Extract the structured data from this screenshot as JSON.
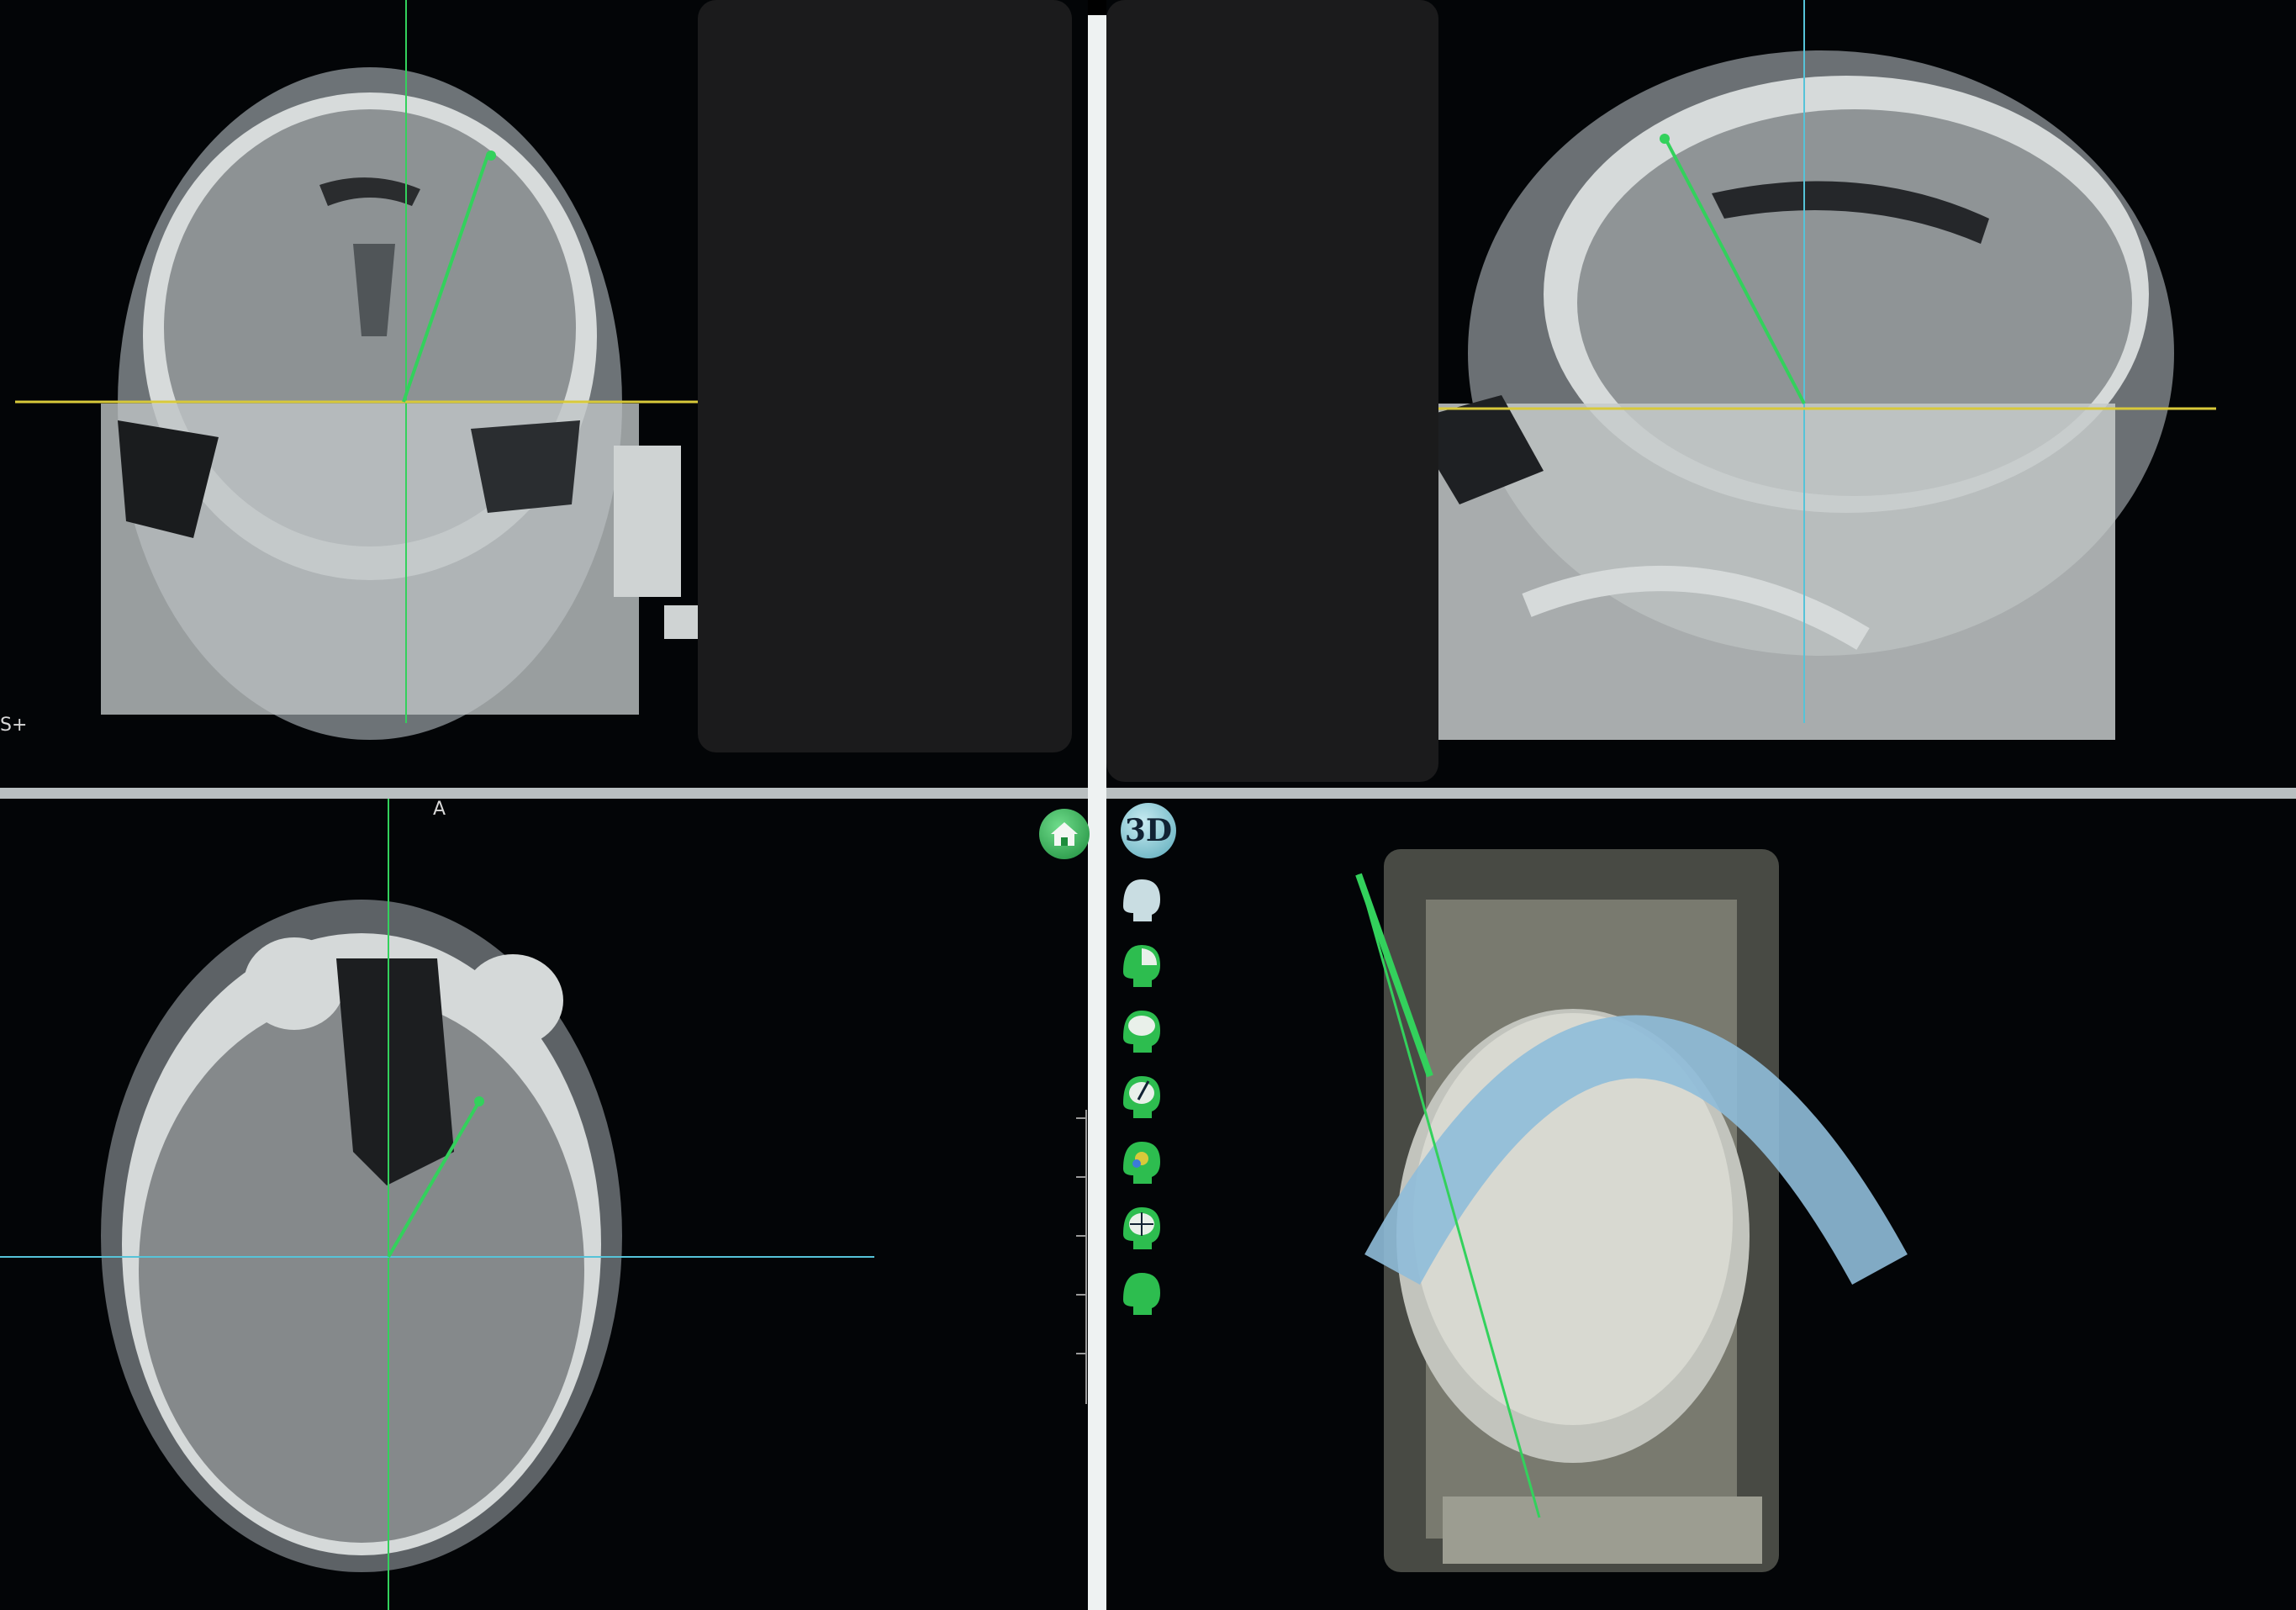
{
  "viewports": {
    "coronal": {
      "corner_label": "S+"
    },
    "axial": {
      "orientation_label": "A"
    },
    "sagittal": {},
    "volume_3d": {}
  },
  "toolbar": {
    "home_icon": "home-icon",
    "view_3d_label": "3D",
    "tools": [
      {
        "icon": "head-view-icon"
      },
      {
        "icon": "head-sagittal-cut-icon"
      },
      {
        "icon": "head-coronal-cut-icon"
      },
      {
        "icon": "head-trajectory-icon"
      },
      {
        "icon": "head-target-icon"
      },
      {
        "icon": "head-crosshair-icon"
      },
      {
        "icon": "head-solid-icon"
      }
    ]
  },
  "colors": {
    "crosshair_green": "#33d15c",
    "crosshair_yellow": "#d8c93a",
    "crosshair_cyan": "#56c3d8",
    "frame_arc": "#8fbcd9",
    "background": "#030507"
  }
}
